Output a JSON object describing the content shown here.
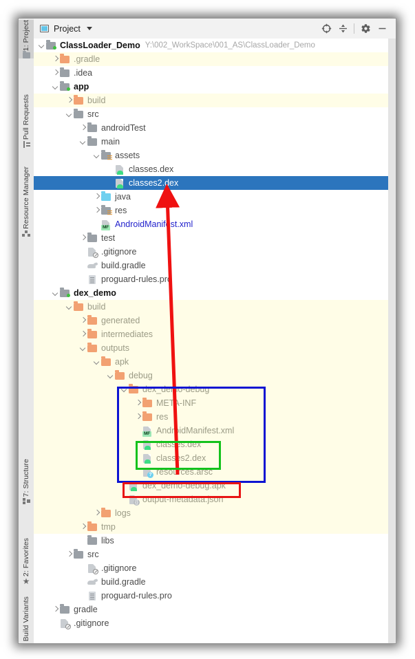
{
  "window": {
    "title": "Project",
    "project_icon": "project-panel-icon",
    "dropdown_icon": "chevron-down-icon"
  },
  "toolwindow_tabs": [
    {
      "label": "1: Project",
      "icon": "project-icon",
      "active": true
    },
    {
      "label": "Pull Requests",
      "icon": "pull-request-icon",
      "active": false
    },
    {
      "label": "Resource Manager",
      "icon": "resource-manager-icon",
      "active": false
    },
    {
      "label": "7: Structure",
      "icon": "structure-icon",
      "active": false
    },
    {
      "label": "2: Favorites",
      "icon": "star-icon",
      "active": false
    },
    {
      "label": "Build Variants",
      "icon": "build-variants-icon",
      "active": false
    }
  ],
  "toolbar_buttons": [
    {
      "name": "select-opened-file-button",
      "icon": "crosshair-icon"
    },
    {
      "name": "collapse-all-button",
      "icon": "collapse-all-icon"
    },
    {
      "name": "settings-button",
      "icon": "gear-icon"
    },
    {
      "name": "hide-button",
      "icon": "minus-icon"
    }
  ],
  "tree": {
    "root_path": "Y:\\002_WorkSpace\\001_AS\\ClassLoader_Demo",
    "rows": [
      {
        "indent": 0,
        "arrow": "down",
        "icon": "folder-gray-module",
        "label": "ClassLoader_Demo",
        "style": "bold",
        "bg": "white",
        "path": "Y:\\002_WorkSpace\\001_AS\\ClassLoader_Demo"
      },
      {
        "indent": 1,
        "arrow": "right",
        "icon": "folder-orange",
        "label": ".gradle",
        "style": "orange",
        "bg": "yellow"
      },
      {
        "indent": 1,
        "arrow": "right",
        "icon": "folder-gray",
        "label": ".idea",
        "style": "gray",
        "bg": "white"
      },
      {
        "indent": 1,
        "arrow": "down",
        "icon": "folder-gray-module",
        "label": "app",
        "style": "bold",
        "bg": "white"
      },
      {
        "indent": 2,
        "arrow": "right",
        "icon": "folder-orange",
        "label": "build",
        "style": "orange",
        "bg": "yellow"
      },
      {
        "indent": 2,
        "arrow": "down",
        "icon": "folder-gray",
        "label": "src",
        "style": "gray",
        "bg": "white"
      },
      {
        "indent": 3,
        "arrow": "right",
        "icon": "folder-gray",
        "label": "androidTest",
        "style": "gray",
        "bg": "white"
      },
      {
        "indent": 3,
        "arrow": "down",
        "icon": "folder-gray",
        "label": "main",
        "style": "gray",
        "bg": "white"
      },
      {
        "indent": 4,
        "arrow": "down",
        "icon": "folder-gray-res",
        "label": "assets",
        "style": "gray",
        "bg": "white"
      },
      {
        "indent": 5,
        "arrow": "none",
        "icon": "dex-file",
        "label": "classes.dex",
        "style": "gray",
        "bg": "white"
      },
      {
        "indent": 5,
        "arrow": "none",
        "icon": "dex-file",
        "label": "classes2.dex",
        "style": "gray",
        "bg": "selected"
      },
      {
        "indent": 4,
        "arrow": "right",
        "icon": "folder-blue",
        "label": "java",
        "style": "gray",
        "bg": "white"
      },
      {
        "indent": 4,
        "arrow": "right",
        "icon": "folder-gray-res",
        "label": "res",
        "style": "gray",
        "bg": "white"
      },
      {
        "indent": 4,
        "arrow": "none",
        "icon": "manifest-file",
        "label": "AndroidManifest.xml",
        "style": "blue",
        "bg": "white"
      },
      {
        "indent": 3,
        "arrow": "right",
        "icon": "folder-gray",
        "label": "test",
        "style": "gray",
        "bg": "white"
      },
      {
        "indent": 3,
        "arrow": "none",
        "icon": "gitignore-file",
        "label": ".gitignore",
        "style": "gray",
        "bg": "white"
      },
      {
        "indent": 3,
        "arrow": "none",
        "icon": "gradle-file",
        "label": "build.gradle",
        "style": "gray",
        "bg": "white"
      },
      {
        "indent": 3,
        "arrow": "none",
        "icon": "pro-file",
        "label": "proguard-rules.pro",
        "style": "gray",
        "bg": "white"
      },
      {
        "indent": 1,
        "arrow": "down",
        "icon": "folder-gray-module",
        "label": "dex_demo",
        "style": "bold",
        "bg": "white"
      },
      {
        "indent": 2,
        "arrow": "down",
        "icon": "folder-orange",
        "label": "build",
        "style": "orange",
        "bg": "yellow"
      },
      {
        "indent": 3,
        "arrow": "right",
        "icon": "folder-orange",
        "label": "generated",
        "style": "orange",
        "bg": "yellow"
      },
      {
        "indent": 3,
        "arrow": "right",
        "icon": "folder-orange",
        "label": "intermediates",
        "style": "orange",
        "bg": "yellow"
      },
      {
        "indent": 3,
        "arrow": "down",
        "icon": "folder-orange",
        "label": "outputs",
        "style": "orange",
        "bg": "yellow"
      },
      {
        "indent": 4,
        "arrow": "down",
        "icon": "folder-orange",
        "label": "apk",
        "style": "orange",
        "bg": "yellow"
      },
      {
        "indent": 5,
        "arrow": "down",
        "icon": "folder-orange",
        "label": "debug",
        "style": "orange",
        "bg": "yellow"
      },
      {
        "indent": 6,
        "arrow": "down",
        "icon": "folder-orange",
        "label": "dex_demo-debug",
        "style": "orange",
        "bg": "yellow"
      },
      {
        "indent": 7,
        "arrow": "right",
        "icon": "folder-orange",
        "label": "META-INF",
        "style": "orange",
        "bg": "yellow"
      },
      {
        "indent": 7,
        "arrow": "right",
        "icon": "folder-orange",
        "label": "res",
        "style": "orange",
        "bg": "yellow"
      },
      {
        "indent": 7,
        "arrow": "none",
        "icon": "manifest-file",
        "label": "AndroidManifest.xml",
        "style": "orange",
        "bg": "yellow"
      },
      {
        "indent": 7,
        "arrow": "none",
        "icon": "dex-file",
        "label": "classes.dex",
        "style": "orange",
        "bg": "yellow"
      },
      {
        "indent": 7,
        "arrow": "none",
        "icon": "dex-file",
        "label": "classes2.dex",
        "style": "orange",
        "bg": "yellow"
      },
      {
        "indent": 7,
        "arrow": "none",
        "icon": "arsc-file",
        "label": "resources.arsc",
        "style": "orange",
        "bg": "yellow"
      },
      {
        "indent": 6,
        "arrow": "none",
        "icon": "apk-file",
        "label": "dex_demo-debug.apk",
        "style": "orange",
        "bg": "yellow"
      },
      {
        "indent": 6,
        "arrow": "none",
        "icon": "json-file",
        "label": "output-metadata.json",
        "style": "orange",
        "bg": "yellow"
      },
      {
        "indent": 4,
        "arrow": "right",
        "icon": "folder-orange",
        "label": "logs",
        "style": "orange",
        "bg": "yellow"
      },
      {
        "indent": 3,
        "arrow": "right",
        "icon": "folder-orange",
        "label": "tmp",
        "style": "orange",
        "bg": "yellow"
      },
      {
        "indent": 3,
        "arrow": "none",
        "icon": "folder-gray",
        "label": "libs",
        "style": "gray",
        "bg": "white"
      },
      {
        "indent": 2,
        "arrow": "right",
        "icon": "folder-gray",
        "label": "src",
        "style": "gray",
        "bg": "white"
      },
      {
        "indent": 3,
        "arrow": "none",
        "icon": "gitignore-file",
        "label": ".gitignore",
        "style": "gray",
        "bg": "white"
      },
      {
        "indent": 3,
        "arrow": "none",
        "icon": "gradle-file",
        "label": "build.gradle",
        "style": "gray",
        "bg": "white"
      },
      {
        "indent": 3,
        "arrow": "none",
        "icon": "pro-file",
        "label": "proguard-rules.pro",
        "style": "gray",
        "bg": "white"
      },
      {
        "indent": 1,
        "arrow": "right",
        "icon": "folder-gray",
        "label": "gradle",
        "style": "gray",
        "bg": "white"
      },
      {
        "indent": 1,
        "arrow": "none",
        "icon": "gitignore-file",
        "label": ".gitignore",
        "style": "gray",
        "bg": "white"
      }
    ]
  },
  "annotations": {
    "blue_box": {
      "color": "#0d14d2",
      "label": "dex_demo-debug-contents-highlight"
    },
    "green_box": {
      "color": "#14c21c",
      "label": "classes-dex-files-highlight"
    },
    "red_box": {
      "color": "#e81414",
      "label": "apk-file-highlight"
    },
    "red_arrow": {
      "color": "#ef1111",
      "label": "arrow-from-apk-classes2-to-assets-classes2"
    }
  },
  "colors": {
    "selection": "#2c75bd",
    "yellow_row": "#fffde7",
    "folder_orange": "#f2a172",
    "folder_gray": "#9aa0a6",
    "folder_blue": "#6fd0ef",
    "link_blue": "#2222cc"
  }
}
